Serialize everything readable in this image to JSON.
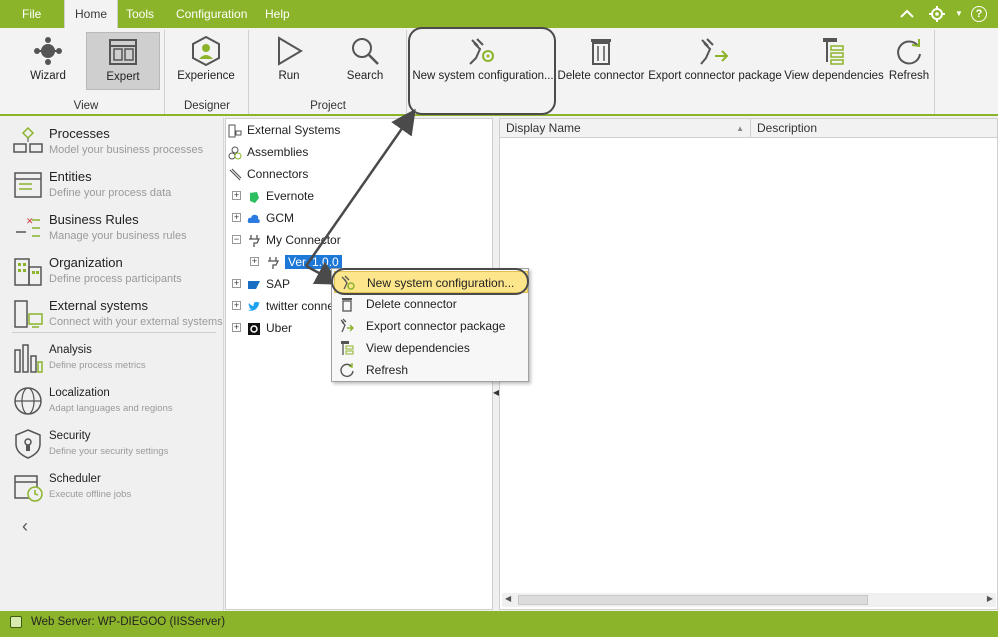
{
  "menu": {
    "tabs": [
      "File",
      "Home",
      "Tools",
      "Configuration",
      "Help"
    ],
    "active_tab": "Home"
  },
  "ribbon": {
    "groups": {
      "view": "View",
      "designer": "Designer",
      "project": "Project"
    },
    "buttons": {
      "wizard": "Wizard",
      "expert": "Expert",
      "experience": "Experience",
      "run": "Run",
      "search": "Search",
      "new_system_configuration": "New system configuration...",
      "delete_connector": "Delete connector",
      "export_connector_package": "Export connector package",
      "view_dependencies": "View dependencies",
      "refresh": "Refresh"
    }
  },
  "leftnav": {
    "items": [
      {
        "title": "Processes",
        "subtitle": "Model your business processes",
        "icon": "processes-icon"
      },
      {
        "title": "Entities",
        "subtitle": "Define your process data",
        "icon": "entities-icon"
      },
      {
        "title": "Business Rules",
        "subtitle": "Manage your business rules",
        "icon": "business-rules-icon"
      },
      {
        "title": "Organization",
        "subtitle": "Define process participants",
        "icon": "organization-icon"
      },
      {
        "title": "External systems",
        "subtitle": "Connect with your external systems",
        "icon": "external-systems-icon"
      }
    ],
    "small_items": [
      {
        "title": "Analysis",
        "subtitle": "Define process metrics",
        "icon": "analysis-icon"
      },
      {
        "title": "Localization",
        "subtitle": "Adapt languages and regions",
        "icon": "globe-icon"
      },
      {
        "title": "Security",
        "subtitle": "Define your security settings",
        "icon": "shield-icon"
      },
      {
        "title": "Scheduler",
        "subtitle": "Execute offline jobs",
        "icon": "scheduler-icon"
      }
    ]
  },
  "tree": {
    "external_systems": "External Systems",
    "assemblies": "Assemblies",
    "connectors": "Connectors",
    "evernote": "Evernote",
    "gcm": "GCM",
    "my_connector": "My Connector",
    "version": "Ver. 1.0.0",
    "sap": "SAP",
    "twitter": "twitter conne",
    "uber": "Uber"
  },
  "grid": {
    "columns": [
      "Display Name",
      "Description"
    ]
  },
  "context_menu": {
    "items": [
      "New system configuration...",
      "Delete connector",
      "Export connector package",
      "View dependencies",
      "Refresh"
    ]
  },
  "status": {
    "text": "Web Server: WP-DIEGOO (IISServer)"
  },
  "colors": {
    "accent": "#8cb42a",
    "selection": "#1e78d7",
    "highlight": "#fce58a"
  }
}
